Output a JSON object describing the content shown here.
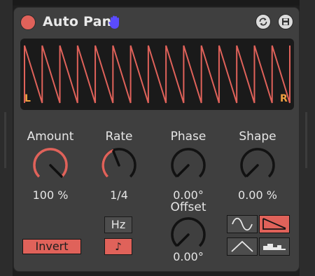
{
  "device": {
    "title": "Auto Pan",
    "icons": {
      "power": "power-toggle-icon",
      "hand": "hand-icon",
      "refresh": "hot-swap-icon",
      "save": "save-preset-icon"
    }
  },
  "display": {
    "left_label": "L",
    "right_label": "R",
    "waveform": "sawtooth-down",
    "cycles": 15
  },
  "params": {
    "amount": {
      "label": "Amount",
      "value": "100 %"
    },
    "rate": {
      "label": "Rate",
      "value": "1/4"
    },
    "phase": {
      "label": "Phase",
      "value": "0.00°"
    },
    "shape": {
      "label": "Shape",
      "value": "0.00 %"
    },
    "offset": {
      "label": "Offset",
      "value": "0.00°"
    }
  },
  "buttons": {
    "invert": "Invert",
    "hz": "Hz",
    "note": "♪"
  },
  "waveform_selector": {
    "options": [
      "sine",
      "sawtooth-down",
      "triangle",
      "random"
    ],
    "selected": "sawtooth-down"
  },
  "colors": {
    "accent": "#e0625a",
    "panel": "#3f3f3f",
    "display_bg": "#1a1a1a",
    "lr_label": "#f0a040",
    "hand": "#5a4bff"
  }
}
